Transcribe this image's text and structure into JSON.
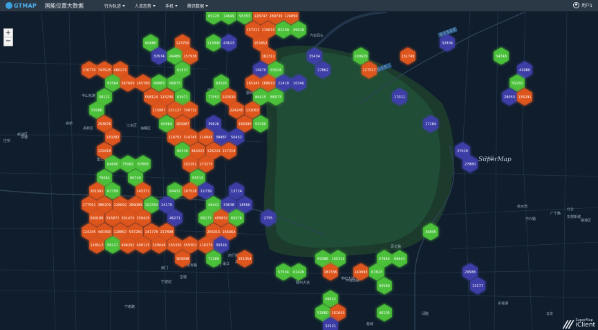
{
  "header": {
    "logo_text": "GTMAP",
    "app_title": "国能位置大数据",
    "menu": [
      {
        "label": "行为轨迹"
      },
      {
        "label": "人流态势"
      },
      {
        "label": "手机"
      },
      {
        "label": "腾讯数据"
      }
    ],
    "user_label": "用户1"
  },
  "map_controls": {
    "zoom_in": "+",
    "zoom_out": "−"
  },
  "watermark": "SuperMap",
  "attribution": {
    "small": "SuperMap",
    "big": "iClient"
  },
  "colors": {
    "orange": "#e2571f",
    "green": "#4cc43a",
    "blue": "#3e3fa8",
    "background": "#0f1d2c"
  },
  "road_labels": [
    "G 1 5 2 2",
    "G 1 5"
  ],
  "place_labels": [
    "汽车码头",
    "宁波港",
    "鄞州区",
    "高新区",
    "江东区",
    "海曙区",
    "新城区",
    "中山东路",
    "民安路",
    "广宁路",
    "中兴路",
    "东部新城",
    "甬江",
    "湖西",
    "药行街",
    "南门",
    "宁波站",
    "东门",
    "百丈路",
    "世纪大道",
    "鄞州大道",
    "环城南路",
    "宁南路",
    "杭州湾",
    "北仑",
    "镇海区",
    "江北区",
    "慈城",
    "庄桥",
    "洪塘",
    "高桥",
    "集士港",
    "五乡",
    "宝幢",
    "邱隘",
    "东钱湖",
    "云龙"
  ],
  "hexbins": [
    {
      "value": "65229",
      "c": "g"
    },
    {
      "value": "74649",
      "c": "g"
    },
    {
      "value": "95353",
      "c": "g"
    },
    {
      "value": "128747",
      "c": "o"
    },
    {
      "value": "289739",
      "c": "o"
    },
    {
      "value": "126890",
      "c": "o"
    },
    {
      "value": "157211",
      "c": "o"
    },
    {
      "value": "119610",
      "c": "o"
    },
    {
      "value": "82209",
      "c": "g"
    },
    {
      "value": "49016",
      "c": "g"
    },
    {
      "value": "60880",
      "c": "g"
    },
    {
      "value": "123750",
      "c": "o"
    },
    {
      "value": "113840",
      "c": "g"
    },
    {
      "value": "43623",
      "c": "b"
    },
    {
      "value": "153452",
      "c": "o"
    },
    {
      "value": "37674",
      "c": "b"
    },
    {
      "value": "49489",
      "c": "g"
    },
    {
      "value": "157938",
      "c": "o"
    },
    {
      "value": "162311",
      "c": "o"
    },
    {
      "value": "35434",
      "c": "b"
    },
    {
      "value": "100629",
      "c": "g"
    },
    {
      "value": "131749",
      "c": "o"
    },
    {
      "value": "32806",
      "c": "b"
    },
    {
      "value": "54748",
      "c": "g"
    },
    {
      "value": "176770",
      "c": "o"
    },
    {
      "value": "743525",
      "c": "o"
    },
    {
      "value": "480271",
      "c": "o"
    },
    {
      "value": "61537",
      "c": "g"
    },
    {
      "value": "19670",
      "c": "b"
    },
    {
      "value": "93924",
      "c": "g"
    },
    {
      "value": "27862",
      "c": "b"
    },
    {
      "value": "127517",
      "c": "o"
    },
    {
      "value": "41980",
      "c": "b"
    },
    {
      "value": "93564",
      "c": "g"
    },
    {
      "value": "567609",
      "c": "o"
    },
    {
      "value": "145780",
      "c": "o"
    },
    {
      "value": "49983",
      "c": "g"
    },
    {
      "value": "66873",
      "c": "g"
    },
    {
      "value": "82026",
      "c": "g"
    },
    {
      "value": "165345",
      "c": "o"
    },
    {
      "value": "188619",
      "c": "o"
    },
    {
      "value": "21418",
      "c": "b"
    },
    {
      "value": "10340",
      "c": "b"
    },
    {
      "value": "55160",
      "c": "g"
    },
    {
      "value": "58121",
      "c": "g"
    },
    {
      "value": "558124",
      "c": "o"
    },
    {
      "value": "113236",
      "c": "o"
    },
    {
      "value": "63071",
      "c": "g"
    },
    {
      "value": "77053",
      "c": "g"
    },
    {
      "value": "102630",
      "c": "o"
    },
    {
      "value": "86415",
      "c": "g"
    },
    {
      "value": "86573",
      "c": "g"
    },
    {
      "value": "17011",
      "c": "b"
    },
    {
      "value": "28053",
      "c": "b"
    },
    {
      "value": "136291",
      "c": "o"
    },
    {
      "value": "55006",
      "c": "g"
    },
    {
      "value": "115887",
      "c": "o"
    },
    {
      "value": "121127",
      "c": "o"
    },
    {
      "value": "748732",
      "c": "o"
    },
    {
      "value": "224245",
      "c": "o"
    },
    {
      "value": "131063",
      "c": "o"
    },
    {
      "value": "293876",
      "c": "o"
    },
    {
      "value": "60864",
      "c": "g"
    },
    {
      "value": "169987",
      "c": "o"
    },
    {
      "value": "39626",
      "c": "b"
    },
    {
      "value": "196090",
      "c": "o"
    },
    {
      "value": "93300",
      "c": "g"
    },
    {
      "value": "17184",
      "c": "b"
    },
    {
      "value": "130282",
      "c": "o"
    },
    {
      "value": "116703",
      "c": "o"
    },
    {
      "value": "314745",
      "c": "o"
    },
    {
      "value": "114945",
      "c": "o"
    },
    {
      "value": "38487",
      "c": "b"
    },
    {
      "value": "50452",
      "c": "b"
    },
    {
      "value": "129418",
      "c": "o"
    },
    {
      "value": "80339",
      "c": "g"
    },
    {
      "value": "344322",
      "c": "o"
    },
    {
      "value": "126224",
      "c": "o"
    },
    {
      "value": "227218",
      "c": "o"
    },
    {
      "value": "37029",
      "c": "b"
    },
    {
      "value": "64690",
      "c": "g"
    },
    {
      "value": "75082",
      "c": "g"
    },
    {
      "value": "87683",
      "c": "g"
    },
    {
      "value": "102291",
      "c": "o"
    },
    {
      "value": "273275",
      "c": "o"
    },
    {
      "value": "27880",
      "c": "b"
    },
    {
      "value": "76061",
      "c": "g"
    },
    {
      "value": "80740",
      "c": "g"
    },
    {
      "value": "55513",
      "c": "g"
    },
    {
      "value": "301391",
      "c": "o"
    },
    {
      "value": "67709",
      "c": "g"
    },
    {
      "value": "145371",
      "c": "o"
    },
    {
      "value": "64432",
      "c": "g"
    },
    {
      "value": "187528",
      "c": "o"
    },
    {
      "value": "11739",
      "c": "b"
    },
    {
      "value": "13724",
      "c": "b"
    },
    {
      "value": "277591",
      "c": "o"
    },
    {
      "value": "386209",
      "c": "o"
    },
    {
      "value": "226692",
      "c": "o"
    },
    {
      "value": "289089",
      "c": "o"
    },
    {
      "value": "102334",
      "c": "g"
    },
    {
      "value": "24179",
      "c": "b"
    },
    {
      "value": "49442",
      "c": "g"
    },
    {
      "value": "33638",
      "c": "b"
    },
    {
      "value": "18560",
      "c": "b"
    },
    {
      "value": "690188",
      "c": "o"
    },
    {
      "value": "316872",
      "c": "o"
    },
    {
      "value": "301470",
      "c": "o"
    },
    {
      "value": "330425",
      "c": "o"
    },
    {
      "value": "46271",
      "c": "b"
    },
    {
      "value": "66177",
      "c": "g"
    },
    {
      "value": "409832",
      "c": "o"
    },
    {
      "value": "69376",
      "c": "g"
    },
    {
      "value": "2755",
      "c": "b"
    },
    {
      "value": "124245",
      "c": "o"
    },
    {
      "value": "440390",
      "c": "o"
    },
    {
      "value": "128897",
      "c": "o"
    },
    {
      "value": "537281",
      "c": "o"
    },
    {
      "value": "141778",
      "c": "o"
    },
    {
      "value": "217898",
      "c": "o"
    },
    {
      "value": "255015",
      "c": "o"
    },
    {
      "value": "166464",
      "c": "o"
    },
    {
      "value": "30845",
      "c": "g"
    },
    {
      "value": "118513",
      "c": "o"
    },
    {
      "value": "99127",
      "c": "g"
    },
    {
      "value": "496292",
      "c": "o"
    },
    {
      "value": "400115",
      "c": "o"
    },
    {
      "value": "320048",
      "c": "o"
    },
    {
      "value": "165330",
      "c": "o"
    },
    {
      "value": "359302",
      "c": "o"
    },
    {
      "value": "116379",
      "c": "o"
    },
    {
      "value": "30316",
      "c": "b"
    },
    {
      "value": "163938",
      "c": "o"
    },
    {
      "value": "71389",
      "c": "g"
    },
    {
      "value": "151354",
      "c": "o"
    },
    {
      "value": "69386",
      "c": "g"
    },
    {
      "value": "105314",
      "c": "g"
    },
    {
      "value": "57864",
      "c": "g"
    },
    {
      "value": "98641",
      "c": "g"
    },
    {
      "value": "57504",
      "c": "g"
    },
    {
      "value": "61426",
      "c": "g"
    },
    {
      "value": "187336",
      "c": "o"
    },
    {
      "value": "140093",
      "c": "o"
    },
    {
      "value": "67823",
      "c": "g"
    },
    {
      "value": "29588",
      "c": "b"
    },
    {
      "value": "93589",
      "c": "g"
    },
    {
      "value": "13177",
      "c": "b"
    },
    {
      "value": "49632",
      "c": "g"
    },
    {
      "value": "51680",
      "c": "g"
    },
    {
      "value": "161643",
      "c": "o"
    },
    {
      "value": "46105",
      "c": "g"
    },
    {
      "value": "32521",
      "c": "b"
    }
  ]
}
